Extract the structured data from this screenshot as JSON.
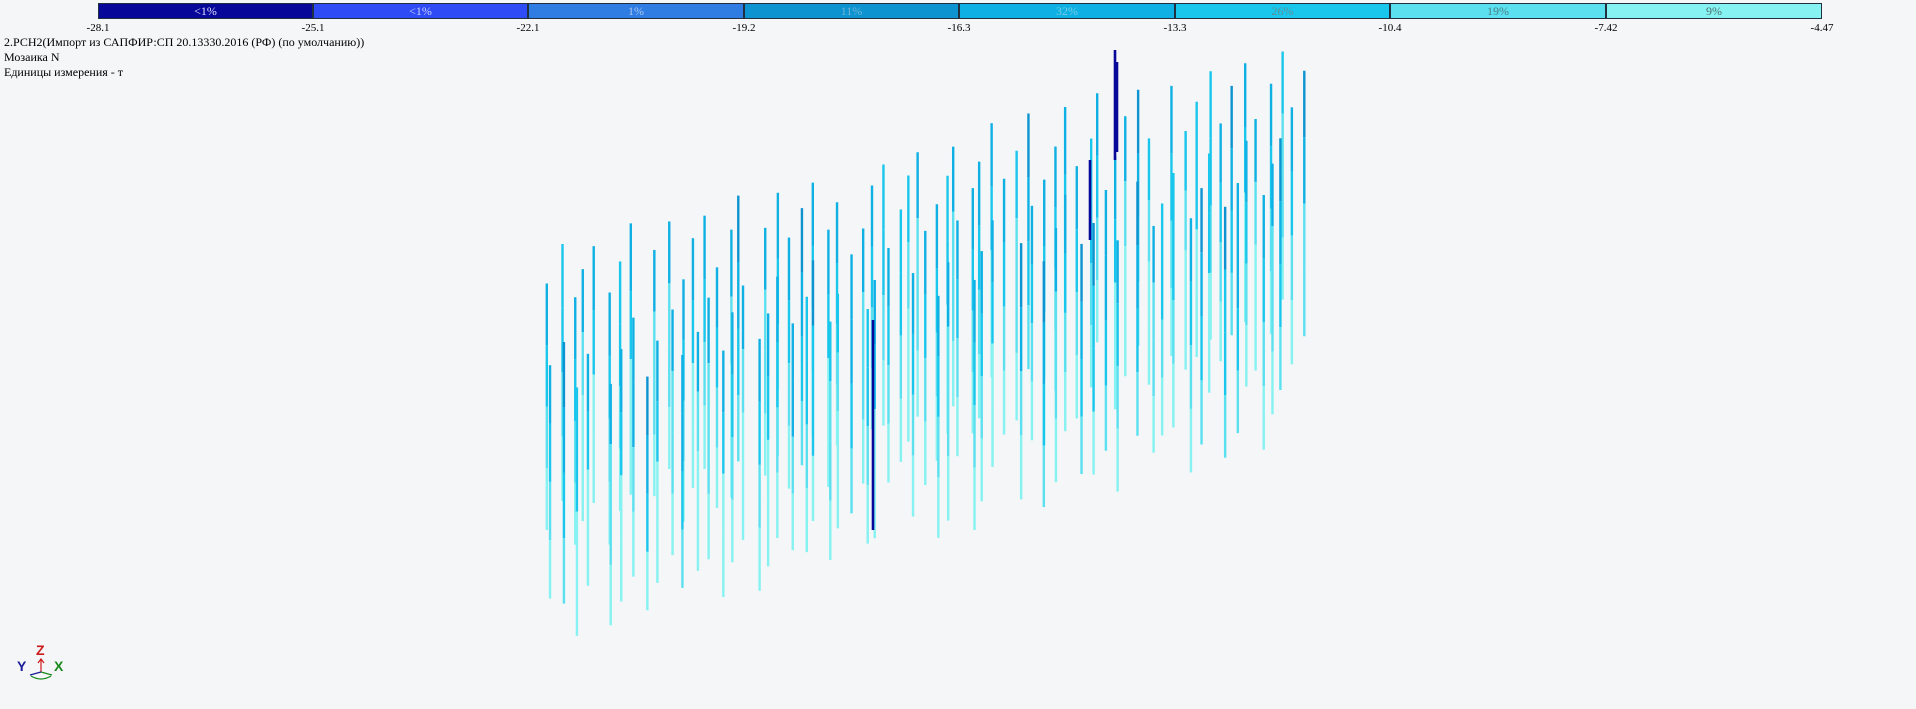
{
  "legend": {
    "segments": [
      {
        "label": "<1%",
        "color": "#07079a",
        "text_color": "#e0e0ff"
      },
      {
        "label": "<1%",
        "color": "#2f4bf5",
        "text_color": "#c8d2ff"
      },
      {
        "label": "1%",
        "color": "#2f7ce3",
        "text_color": "#a9c8ef"
      },
      {
        "label": "11%",
        "color": "#0d93d0",
        "text_color": "#6fb5d6"
      },
      {
        "label": "32%",
        "color": "#0fb0e3",
        "text_color": "#76cbe6"
      },
      {
        "label": "26%",
        "color": "#19c6ec",
        "text_color": "#5c8e9a"
      },
      {
        "label": "19%",
        "color": "#5ae0ef",
        "text_color": "#4a7e86"
      },
      {
        "label": "9%",
        "color": "#86f2f1",
        "text_color": "#4b7373"
      }
    ],
    "ticks": [
      "-28.1",
      "-25.1",
      "-22.1",
      "-19.2",
      "-16.3",
      "-13.3",
      "-10.4",
      "-7.42",
      "-4.47"
    ]
  },
  "info": {
    "load_case": "2.РСН2(Импорт из САПФИР:СП 20.13330.2016 (РФ) (по умолчанию))",
    "mosaic": "Мозаика N",
    "units": "Единицы измерения - т"
  },
  "axes": {
    "y_label": "Y",
    "z_label": "Z",
    "x_label": "X",
    "y_color": "#1a1a9a",
    "z_color": "#cc1a1a",
    "x_color": "#1a8a1a"
  }
}
